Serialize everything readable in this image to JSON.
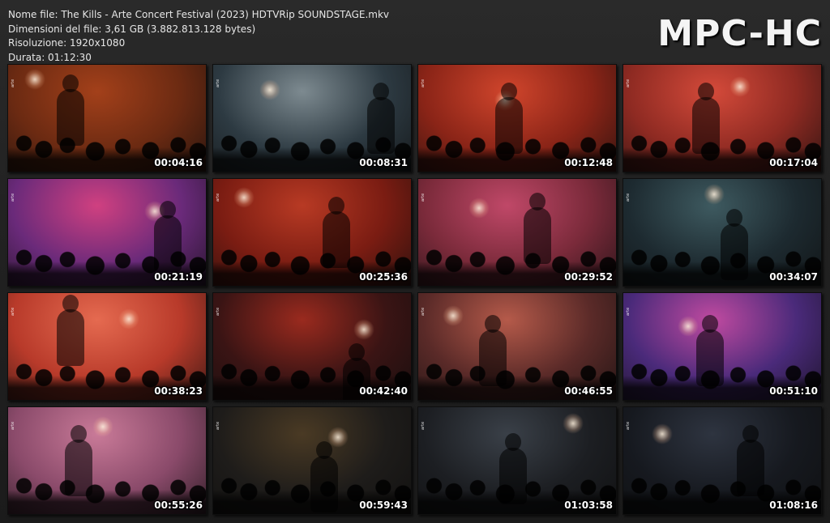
{
  "info": {
    "filename": "Nome file: The Kills - Arte Concert Festival (2023) HDTVRip SOUNDSTAGE.mkv",
    "filesize": "Dimensioni del file: 3,61 GB (3.882.813.128 bytes)",
    "resolution": "Risoluzione: 1920x1080",
    "duration": "Durata: 01:12:30"
  },
  "logo": "MPC-HC",
  "watermark": "arte",
  "thumbnails": [
    {
      "time": "00:04:16",
      "bg": "#6b2a12",
      "accent": "#a3401a"
    },
    {
      "time": "00:08:31",
      "bg": "#2d3a42",
      "accent": "#7d8a90"
    },
    {
      "time": "00:12:48",
      "bg": "#8a2417",
      "accent": "#d0452c"
    },
    {
      "time": "00:17:04",
      "bg": "#8e2a22",
      "accent": "#d44a3a"
    },
    {
      "time": "00:21:19",
      "bg": "#6a2a7a",
      "accent": "#d04080"
    },
    {
      "time": "00:25:36",
      "bg": "#7a1c12",
      "accent": "#b83a24"
    },
    {
      "time": "00:29:52",
      "bg": "#7a2a3a",
      "accent": "#c04868"
    },
    {
      "time": "00:34:07",
      "bg": "#1d2a30",
      "accent": "#3e5a60"
    },
    {
      "time": "00:38:23",
      "bg": "#b83a2a",
      "accent": "#e56a50"
    },
    {
      "time": "00:42:40",
      "bg": "#3a1414",
      "accent": "#9a2a1e"
    },
    {
      "time": "00:46:55",
      "bg": "#5a2a28",
      "accent": "#b55a4a"
    },
    {
      "time": "00:51:10",
      "bg": "#4a2a7a",
      "accent": "#c04aa0"
    },
    {
      "time": "00:55:26",
      "bg": "#8a4a6a",
      "accent": "#c97a98"
    },
    {
      "time": "00:59:43",
      "bg": "#1e1c1a",
      "accent": "#4a3a24"
    },
    {
      "time": "01:03:58",
      "bg": "#1c1e22",
      "accent": "#3a4048"
    },
    {
      "time": "01:08:16",
      "bg": "#16191f",
      "accent": "#2e3440"
    }
  ]
}
